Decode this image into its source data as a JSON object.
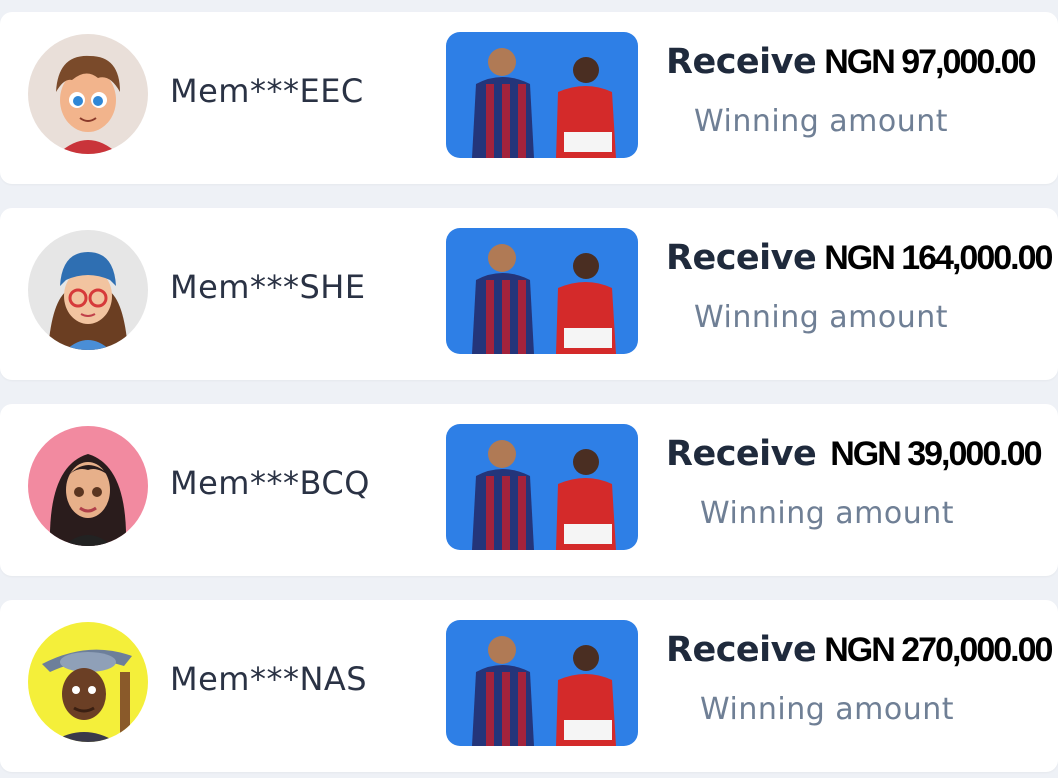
{
  "winners": [
    {
      "member": "Mem***EEC",
      "receive_label": "Receive",
      "amount": "NGN 97,000.00",
      "subtitle": "Winning amount",
      "avatar_icon": "boy-avatar-icon"
    },
    {
      "member": "Mem***SHE",
      "receive_label": "Receive",
      "amount": "NGN 164,000.00",
      "subtitle": "Winning amount",
      "avatar_icon": "girl-glasses-avatar-icon"
    },
    {
      "member": "Mem***BCQ",
      "receive_label": "Receive",
      "amount": "NGN 39,000.00",
      "subtitle": "Winning amount",
      "avatar_icon": "woman-avatar-icon"
    },
    {
      "member": "Mem***NAS",
      "receive_label": "Receive",
      "amount": "NGN 270,000.00",
      "subtitle": "Winning amount",
      "avatar_icon": "musician-avatar-icon"
    }
  ],
  "game_thumbnail_icon": "football-players-thumbnail",
  "colors": {
    "card": "#ffffff",
    "background": "#eef1f6",
    "thumb_blue": "#2e7fe6",
    "subtitle": "#6f7f95"
  }
}
